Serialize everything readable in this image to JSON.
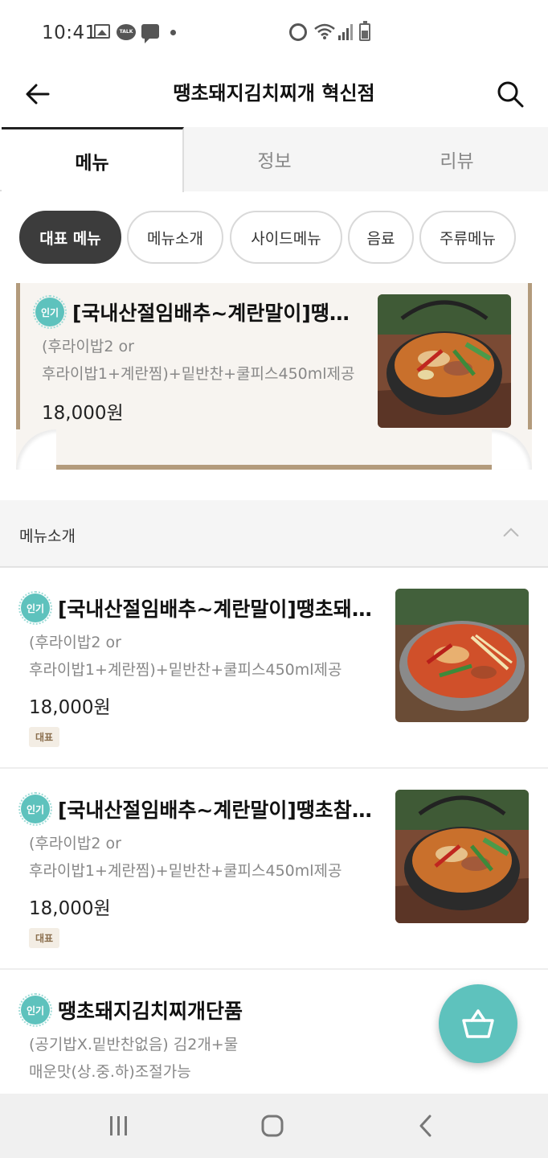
{
  "status_bar": {
    "time": "10:41",
    "talk_label": "TALK"
  },
  "header": {
    "title": "땡초돼지김치찌개 혁신점"
  },
  "tabs": [
    {
      "label": "메뉴"
    },
    {
      "label": "정보"
    },
    {
      "label": "리뷰"
    }
  ],
  "chips": [
    {
      "label": "대표 메뉴"
    },
    {
      "label": "메뉴소개"
    },
    {
      "label": "사이드메뉴"
    },
    {
      "label": "음료"
    },
    {
      "label": "주류메뉴"
    }
  ],
  "featured": {
    "badge": "인기",
    "title": "[국내산절임배추~계란말이]땡초돼지김치찌개",
    "desc_line1": "(후라이밥2 or",
    "desc_line2": "후라이밥1+계란찜)+밑반찬+쿨피스450ml제공",
    "price": "18,000원"
  },
  "section": {
    "title": "메뉴소개"
  },
  "items": [
    {
      "badge": "인기",
      "title": "[국내산절임배추~계란말이]땡초돼지김치찌개",
      "desc_line1": "(후라이밥2 or",
      "desc_line2": "후라이밥1+계란찜)+밑반찬+쿨피스450ml제공",
      "price": "18,000원",
      "tag": "대표"
    },
    {
      "badge": "인기",
      "title": "[국내산절임배추~계란말이]땡초참치김치찌개",
      "desc_line1": "(후라이밥2 or",
      "desc_line2": "후라이밥1+계란찜)+밑반찬+쿨피스450ml제공",
      "price": "18,000원",
      "tag": "대표"
    },
    {
      "badge": "인기",
      "title": "땡초돼지김치찌개단품",
      "desc_line1": "(공기밥X.밑반찬없음) 김2개+물",
      "desc_line2": "매운맛(상.중.하)조절가능"
    }
  ],
  "colors": {
    "accent": "#5ec2bd",
    "active_chip": "#3c3c3c",
    "frame": "#b39b7c"
  },
  "icons": {
    "back": "arrow-left-icon",
    "search": "search-icon",
    "collapse": "chevron-up-icon",
    "cart": "basket-icon",
    "nav_recent": "recent-apps-icon",
    "nav_home": "home-icon",
    "nav_back": "nav-back-icon"
  }
}
